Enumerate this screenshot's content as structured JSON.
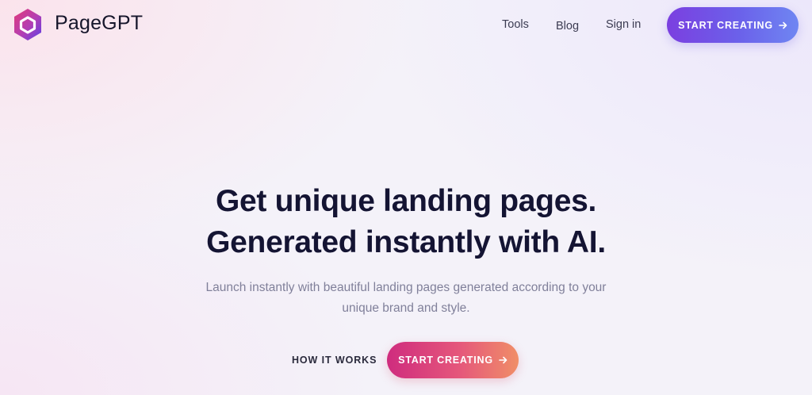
{
  "header": {
    "brand": "PageGPT",
    "nav": {
      "tools": "Tools",
      "blog": "Blog",
      "sign_in": "Sign in"
    },
    "cta_label": "START CREATING"
  },
  "hero": {
    "title_line1": "Get unique landing pages.",
    "title_line2": "Generated instantly with AI.",
    "subtitle_line1": "Launch instantly with beautiful landing pages generated according to your",
    "subtitle_line2": "unique brand and style.",
    "secondary_link": "HOW IT WORKS",
    "cta_label": "START CREATING"
  },
  "icons": {
    "logo": "hexagon-logo-icon",
    "arrow": "arrow-right-icon"
  },
  "colors": {
    "header_cta_gradient": [
      "#7b3fe0",
      "#6f86f2"
    ],
    "hero_cta_gradient": [
      "#cf2c7e",
      "#f08e67"
    ],
    "logo_gradient": [
      "#d2347f",
      "#6a3fe0"
    ],
    "title": "#141433",
    "subtitle": "#80809a"
  }
}
